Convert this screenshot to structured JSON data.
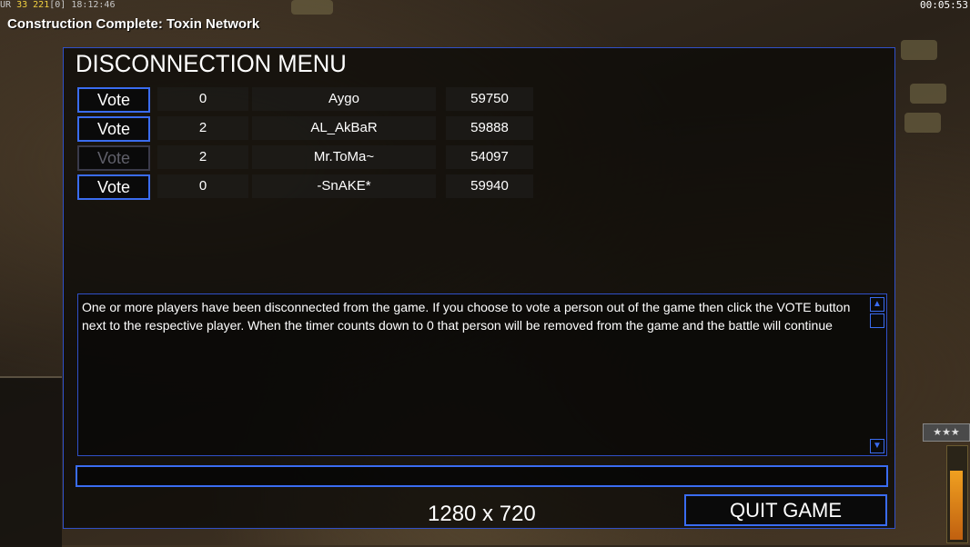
{
  "hud": {
    "top_left_prefix": "UR",
    "top_left_a": "33",
    "top_left_b": "221",
    "top_left_c": "[0]",
    "top_left_time": "18:12:46",
    "top_right_time": "00:05:53",
    "notice": "Construction Complete: Toxin Network",
    "rank_stars": "★★★"
  },
  "dialog": {
    "title": "DISCONNECTION MENU",
    "players": [
      {
        "vote_label": "Vote",
        "vote_enabled": true,
        "count": "0",
        "name": "Aygo",
        "score": "59750"
      },
      {
        "vote_label": "Vote",
        "vote_enabled": true,
        "count": "2",
        "name": "AL_AkBaR",
        "score": "59888"
      },
      {
        "vote_label": "Vote",
        "vote_enabled": false,
        "count": "2",
        "name": "Mr.ToMa~",
        "score": "54097"
      },
      {
        "vote_label": "Vote",
        "vote_enabled": true,
        "count": "0",
        "name": "-SnAKE*",
        "score": "59940"
      }
    ],
    "message": "One or more players have been disconnected from the game. If you choose to vote a person out of the game then click the VOTE button next to the respective player. When the timer counts down to 0 that person will be removed from the game and the battle will continue",
    "resolution": "1280 x 720",
    "quit_label": "QUIT GAME"
  },
  "colors": {
    "accent": "#3a6cf0",
    "disabled": "#3a3a4a",
    "hud_yellow": "#f0d040"
  },
  "icons": {
    "scroll_up": "triangle-up-icon",
    "scroll_down": "triangle-down-icon"
  },
  "power_level": 0.78
}
